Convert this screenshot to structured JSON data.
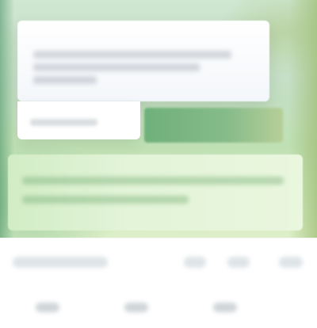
{
  "screen": {
    "title": "",
    "note": ""
  },
  "card": {
    "heading": "",
    "subtext": ""
  },
  "actions": {
    "primary_label": ""
  },
  "input": {
    "placeholder": ""
  },
  "list_row": {
    "label": "",
    "meta1": "",
    "meta2": "",
    "meta3": ""
  },
  "nav": {
    "items": [
      {
        "label": ""
      },
      {
        "label": ""
      },
      {
        "label": ""
      }
    ]
  },
  "colors": {
    "accent_green": "#6fb07a",
    "panel_green": "#d2edc6",
    "background": "#ffffff",
    "muted_text": "#8e98a0"
  },
  "icons": {
    "nav_1": "home-icon",
    "nav_2": "search-icon",
    "nav_3": "profile-icon"
  }
}
